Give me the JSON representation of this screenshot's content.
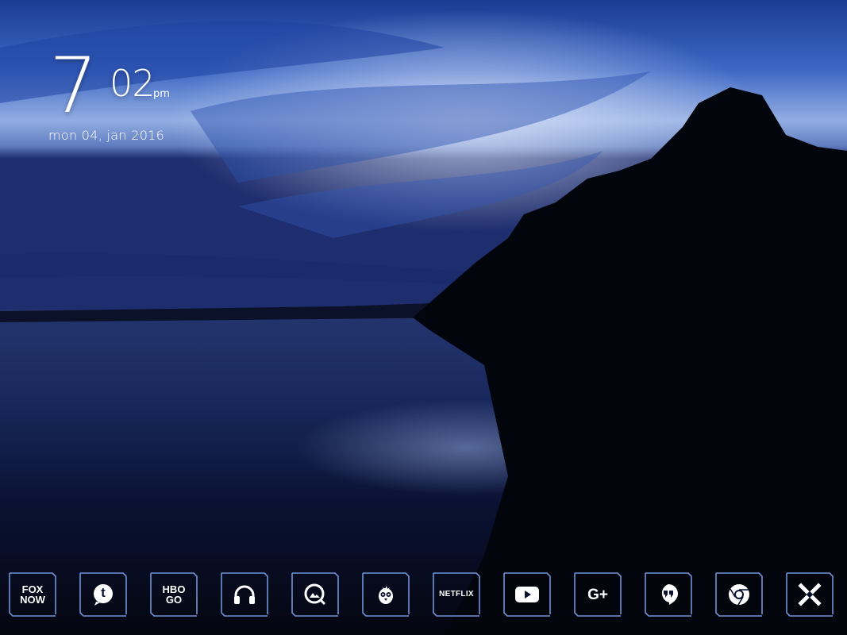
{
  "clock": {
    "hour": "7",
    "minute": "02",
    "ampm": "pm",
    "date": "mon 04, jan 2016"
  },
  "colors": {
    "accent": "#6f93d6",
    "glyph": "#ffffff"
  },
  "dock": {
    "apps": [
      {
        "name": "fox-now",
        "line1": "FOX",
        "line2": "NOW"
      },
      {
        "name": "tumblr",
        "letter": "t"
      },
      {
        "name": "hbo-go",
        "line1": "HBO",
        "line2": "GO"
      },
      {
        "name": "music-headphones"
      },
      {
        "name": "photos"
      },
      {
        "name": "bird-app"
      },
      {
        "name": "netflix",
        "text": "NETFLIX"
      },
      {
        "name": "youtube"
      },
      {
        "name": "google-plus",
        "text": "G+"
      },
      {
        "name": "hangouts"
      },
      {
        "name": "chrome"
      },
      {
        "name": "x-app"
      }
    ]
  }
}
